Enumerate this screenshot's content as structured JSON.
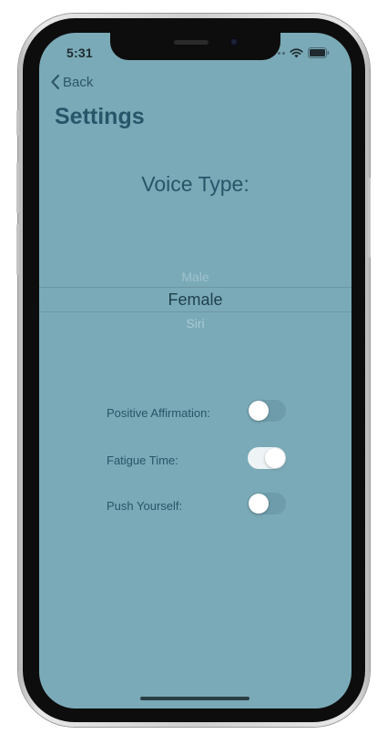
{
  "status_bar": {
    "time": "5:31"
  },
  "nav": {
    "back_label": "Back"
  },
  "page": {
    "title": "Settings"
  },
  "voice_type": {
    "heading": "Voice Type:",
    "options": [
      "Male",
      "Female",
      "Siri"
    ],
    "selected": "Female"
  },
  "settings": [
    {
      "label": "Positive Affirmation:",
      "enabled": false
    },
    {
      "label": "Fatigue Time:",
      "enabled": true
    },
    {
      "label": "Push Yourself:",
      "enabled": false
    }
  ],
  "colors": {
    "background": "#7aaab7",
    "text": "#27566a",
    "toggle_off": "#6f9caa",
    "toggle_on": "#eef3f5"
  }
}
